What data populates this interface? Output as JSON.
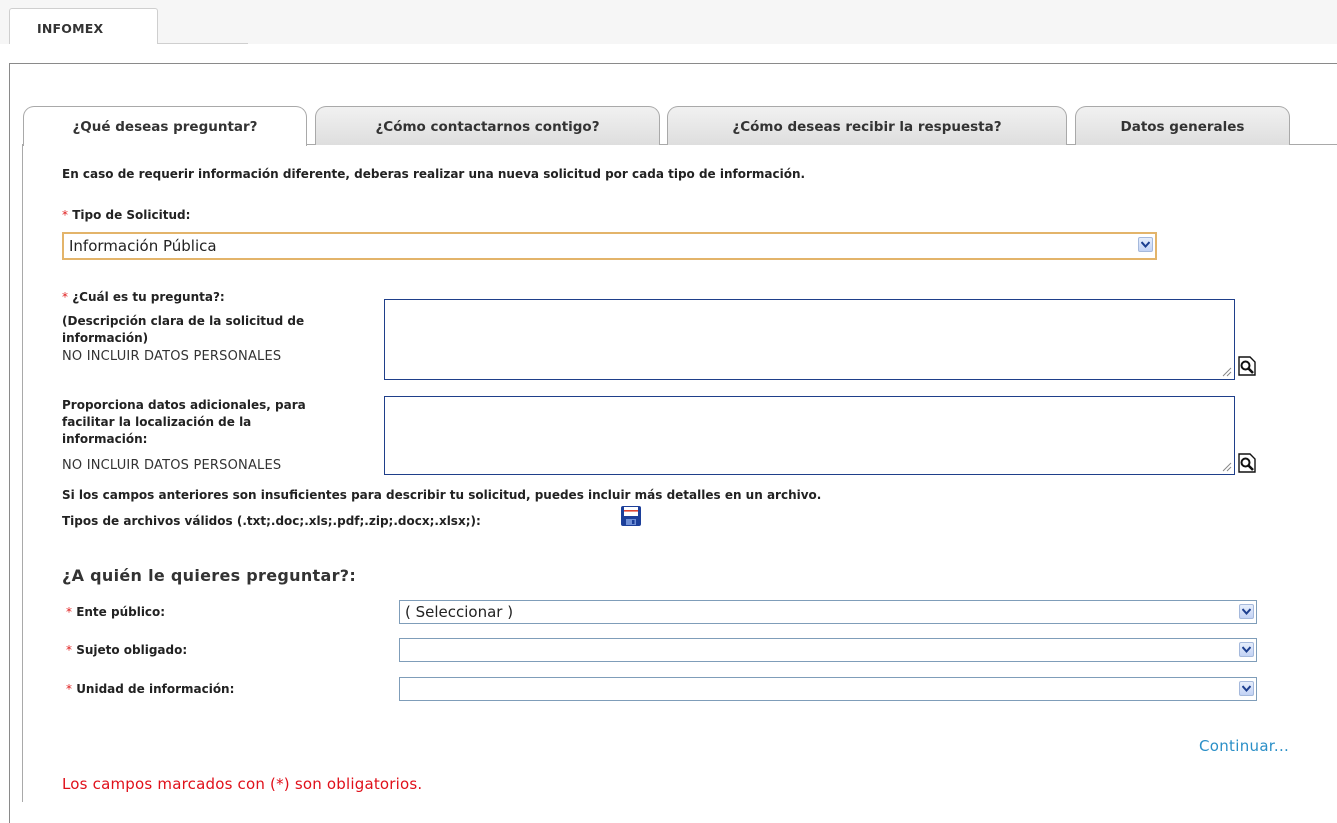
{
  "app": {
    "top_tab": "INFOMEX"
  },
  "tabs": [
    {
      "label": "¿Qué deseas preguntar?",
      "active": true
    },
    {
      "label": "¿Cómo contactarnos contigo?",
      "active": false
    },
    {
      "label": "¿Cómo deseas recibir la respuesta?",
      "active": false
    },
    {
      "label": "Datos generales",
      "active": false
    }
  ],
  "form": {
    "intro": "En caso de requerir información diferente, deberas realizar una nueva solicitud por cada tipo de información.",
    "required_mark": "*",
    "tipo": {
      "label": "Tipo de Solicitud:",
      "value": "Información Pública"
    },
    "pregunta": {
      "label": "¿Cuál es tu pregunta?:",
      "line1": "(Descripción clara de la solicitud de",
      "line2": "información)",
      "note": "NO INCLUIR DATOS PERSONALES",
      "value": ""
    },
    "adicionales": {
      "line1": "Proporciona datos adicionales, para",
      "line2": "facilitar la localización de la",
      "line3": "información:",
      "note": "NO INCLUIR DATOS PERSONALES",
      "value": ""
    },
    "archivo_info": "Si los campos anteriores son insuficientes para describir tu solicitud, puedes incluir más detalles en un archivo.",
    "archivo_tipos": "Tipos de archivos válidos (.txt;.doc;.xls;.pdf;.zip;.docx;.xlsx;):",
    "section_title": "¿A quién le quieres preguntar?:",
    "ente": {
      "label": "Ente público:",
      "value": "( Seleccionar )"
    },
    "sujeto": {
      "label": "Sujeto obligado:",
      "value": ""
    },
    "unidad": {
      "label": "Unidad de información:",
      "value": ""
    },
    "continuar": "Continuar...",
    "footer": "Los campos marcados con (*) son obligatorios."
  },
  "icons": {
    "dropdown": "chevron-down-icon",
    "zoom": "magnifier-icon",
    "save": "floppy-disk-icon",
    "resize": "resize-grip-icon"
  },
  "colors": {
    "required": "#e02020",
    "link": "#2a8fc7",
    "input_border": "#1f3f8a",
    "focus_border": "#e3b46a"
  }
}
